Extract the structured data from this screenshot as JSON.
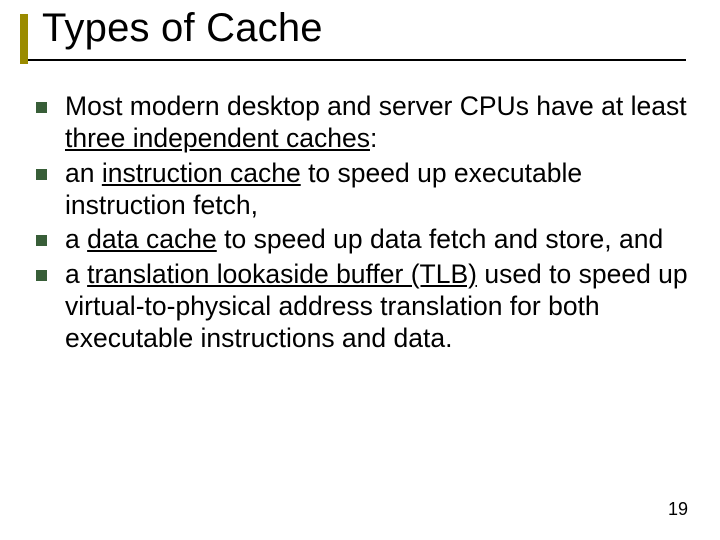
{
  "title": "Types of Cache",
  "bullets": [
    {
      "pre": "Most modern desktop and server CPUs have at least ",
      "u": "three independent caches",
      "post": ":"
    },
    {
      "pre": "an ",
      "u": "instruction cache",
      "post": " to speed up executable instruction fetch,"
    },
    {
      "pre": "a ",
      "u": "data cache",
      "post": " to speed up data fetch and store, and"
    },
    {
      "pre": "a ",
      "u": "translation lookaside buffer (TLB)",
      "post": " used to speed up virtual-to-physical address translation for both executable instructions and data."
    }
  ],
  "page_number": "19",
  "colors": {
    "title_accent": "#9a8b00",
    "bullet": "#385e38"
  }
}
